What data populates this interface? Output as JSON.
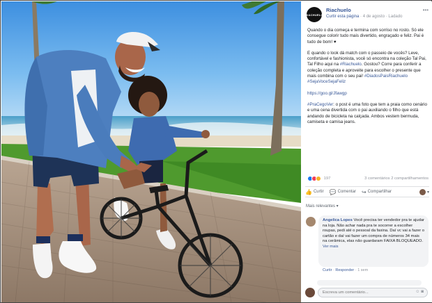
{
  "post": {
    "page_name": "Riachuelo",
    "logo_text": "RIACHUELO",
    "meta": {
      "action": "Curtir esta página",
      "date": "4 de agosto",
      "privacy": "Ladado"
    },
    "paragraphs": [
      {
        "text": "Quando o dia começa e termina com sorriso no rosto. Só ele consegue colorir tudo mais divertido, engraçado e feliz. Pai é tudo de bom! ♥"
      },
      {
        "text": "E quando o look dá match com o passeio de vocês? Leve, confortável e fashionista, você só encontra na coleção Tal Pai, Tal Filho aqui na ",
        "link": "#Riachuelo",
        "after": ". Gostou? Corre para conferir a coleção completa e aproveite para escolher o presente que mais combina com o seu pai! ",
        "hashtags": "#DiadosPaisRiachuelo #SejaVoceSejaFeliz"
      },
      {
        "text": "",
        "link": "https://goo.gl/Jfawgp"
      },
      {
        "hashtag": "#PraCegoVer",
        "text": ": o post é uma foto que tem a praia como cenário e uma cena divertida com o pai auxiliando o filho que está andando de bicicleta na calçada. Ambos vestem bermuda, camiseta e camisa jeans."
      }
    ]
  },
  "reactions": {
    "count": "197",
    "comments": "3 comentários",
    "shares": "2 compartilhamentos"
  },
  "actions": {
    "like": "Curtir",
    "comment": "Comentar",
    "share": "Compartilhar"
  },
  "comments_section": {
    "filter": "Mais relevantes ▾",
    "first": {
      "author": "Angelica Lopes",
      "text": "Você precisa ter vendedor pra te ajudar na loja. Não achar nada pra te socorrer a escolher roupas, pedi até o pessoal da faxina. Daí vc vai a fazer o cartão e daí vai fazer um compra de números 34 mais na cerâmica, elas não guardaram FAIXA BLOQUEADO.",
      "see_more": "Ver mais",
      "like": "Curtir",
      "reply": "Responder",
      "time": "1 sem"
    },
    "write_placeholder": "Escreva um comentário..."
  }
}
